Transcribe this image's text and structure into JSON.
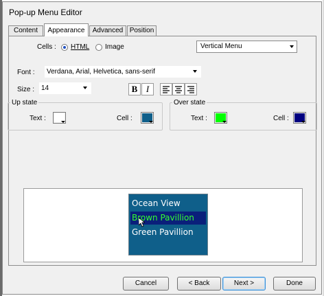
{
  "window": {
    "title": "Pop-up Menu Editor"
  },
  "tabs": [
    {
      "label": "Content"
    },
    {
      "label": "Appearance",
      "active": true
    },
    {
      "label": "Advanced"
    },
    {
      "label": "Position"
    }
  ],
  "cells": {
    "label": "Cells :",
    "options": [
      {
        "label": "HTML",
        "selected": true
      },
      {
        "label": "Image",
        "selected": false
      }
    ],
    "orientation": "Vertical Menu"
  },
  "font": {
    "label": "Font :",
    "value": "Verdana, Arial, Helvetica, sans-serif"
  },
  "size": {
    "label": "Size :",
    "value": "14"
  },
  "style_buttons": {
    "bold": "B",
    "italic": "I"
  },
  "up_state": {
    "legend": "Up state",
    "text_label": "Text :",
    "cell_label": "Cell :",
    "text_color": "#ffffff",
    "cell_color": "#0f5f8a"
  },
  "over_state": {
    "legend": "Over state",
    "text_label": "Text :",
    "cell_label": "Cell :",
    "text_color": "#00ff00",
    "cell_color": "#000080"
  },
  "preview": {
    "items": [
      {
        "label": "Ocean View"
      },
      {
        "label": "Brown Pavillion",
        "hover": true
      },
      {
        "label": "Green Pavillion"
      }
    ]
  },
  "buttons": {
    "cancel": "Cancel",
    "back": "< Back",
    "next": "Next >",
    "done": "Done"
  }
}
